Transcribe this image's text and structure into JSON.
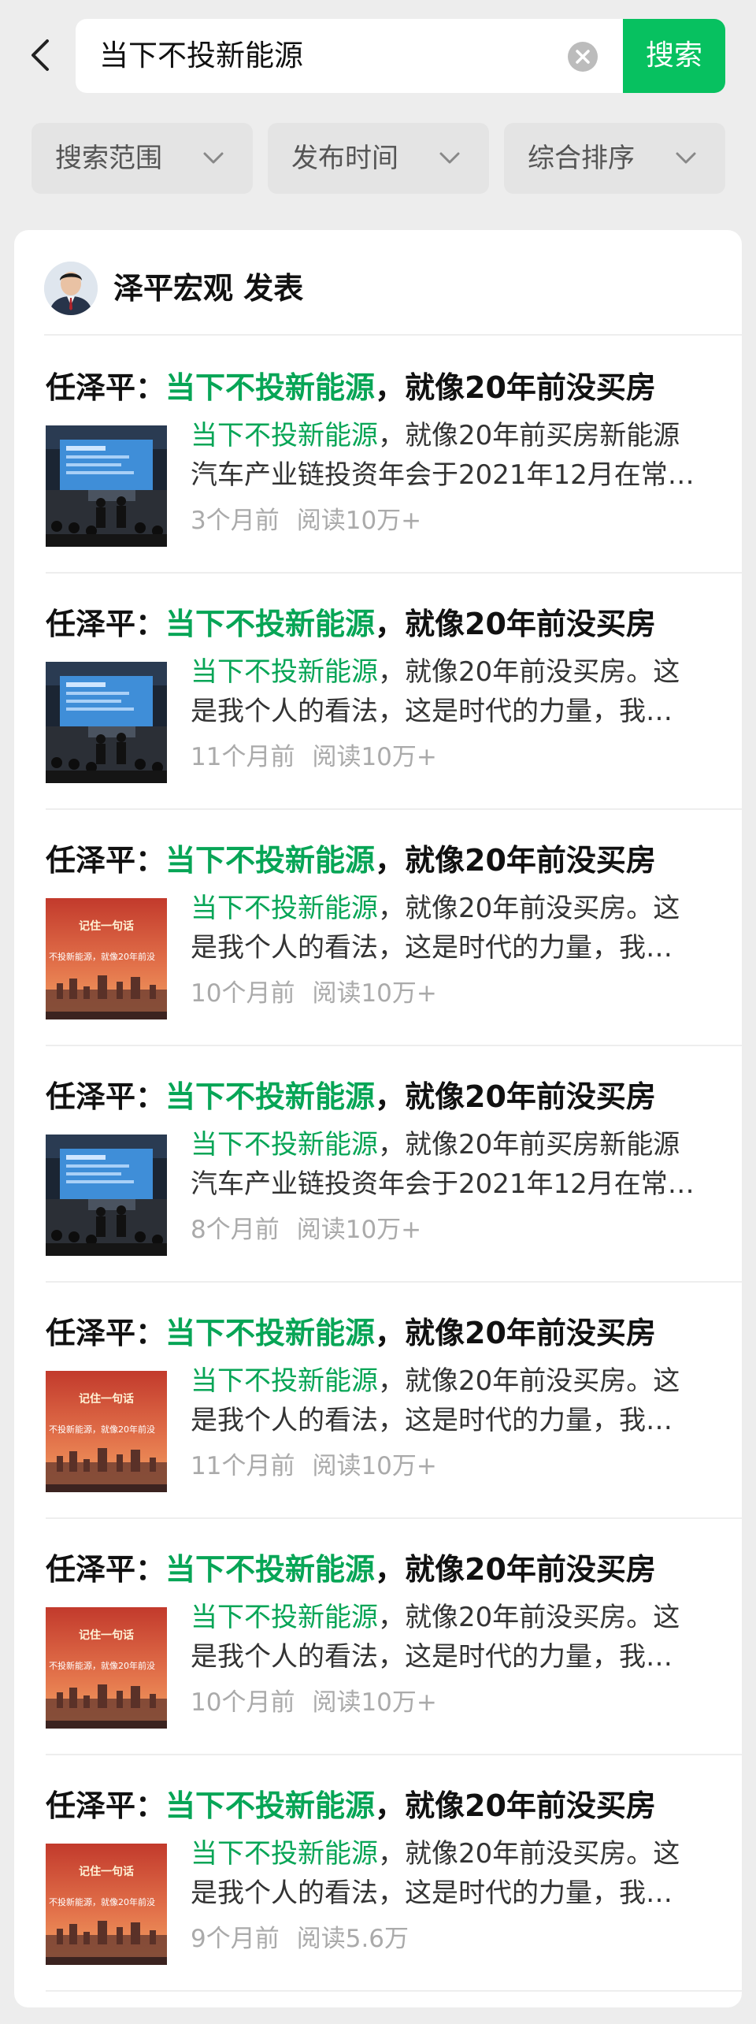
{
  "search": {
    "query": "当下不投新能源",
    "button_label": "搜索"
  },
  "filters": [
    {
      "label": "搜索范围"
    },
    {
      "label": "发布时间"
    },
    {
      "label": "综合排序"
    }
  ],
  "author": {
    "name": "泽平宏观 发表"
  },
  "results": [
    {
      "title_prefix": "任泽平：",
      "title_highlight": "当下不投新能源",
      "title_suffix": "，就像20年前没买房",
      "snippet_highlight": "当下不投新能源",
      "snippet_line1": "，就像20年前买房新能源",
      "snippet_line2": "汽车产业链投资年会于2021年12月在常…",
      "time": "3个月前",
      "reads": "阅读10万+",
      "thumb": "conference"
    },
    {
      "title_prefix": "任泽平：",
      "title_highlight": "当下不投新能源",
      "title_suffix": "，就像20年前没买房",
      "snippet_highlight": "当下不投新能源",
      "snippet_line1": "，就像20年前没买房。这",
      "snippet_line2": "是我个人的看法，这是时代的力量，我…",
      "time": "11个月前",
      "reads": "阅读10万+",
      "thumb": "conference"
    },
    {
      "title_prefix": "任泽平：",
      "title_highlight": "当下不投新能源",
      "title_suffix": "，就像20年前没买房",
      "snippet_highlight": "当下不投新能源",
      "snippet_line1": "，就像20年前没买房。这",
      "snippet_line2": "是我个人的看法，这是时代的力量，我…",
      "time": "10个月前",
      "reads": "阅读10万+",
      "thumb": "poster"
    },
    {
      "title_prefix": "任泽平：",
      "title_highlight": "当下不投新能源",
      "title_suffix": "，就像20年前没买房",
      "snippet_highlight": "当下不投新能源",
      "snippet_line1": "，就像20年前买房新能源",
      "snippet_line2": "汽车产业链投资年会于2021年12月在常…",
      "time": "8个月前",
      "reads": "阅读10万+",
      "thumb": "conference"
    },
    {
      "title_prefix": "任泽平：",
      "title_highlight": "当下不投新能源",
      "title_suffix": "，就像20年前没买房",
      "snippet_highlight": "当下不投新能源",
      "snippet_line1": "，就像20年前没买房。这",
      "snippet_line2": "是我个人的看法，这是时代的力量，我…",
      "time": "11个月前",
      "reads": "阅读10万+",
      "thumb": "poster"
    },
    {
      "title_prefix": "任泽平：",
      "title_highlight": "当下不投新能源",
      "title_suffix": "，就像20年前没买房",
      "snippet_highlight": "当下不投新能源",
      "snippet_line1": "，就像20年前没买房。这",
      "snippet_line2": "是我个人的看法，这是时代的力量，我…",
      "time": "10个月前",
      "reads": "阅读10万+",
      "thumb": "poster"
    },
    {
      "title_prefix": "任泽平：",
      "title_highlight": "当下不投新能源",
      "title_suffix": "，就像20年前没买房",
      "snippet_highlight": "当下不投新能源",
      "snippet_line1": "，就像20年前没买房。这",
      "snippet_line2": "是我个人的看法，这是时代的力量，我…",
      "time": "9个月前",
      "reads": "阅读5.6万",
      "thumb": "poster"
    }
  ],
  "poster_text": {
    "headline": "记住一句话",
    "subline": "不投新能源，就像20年前没"
  },
  "colors": {
    "accent": "#07c160",
    "highlight": "#07a556",
    "background": "#ededed"
  }
}
